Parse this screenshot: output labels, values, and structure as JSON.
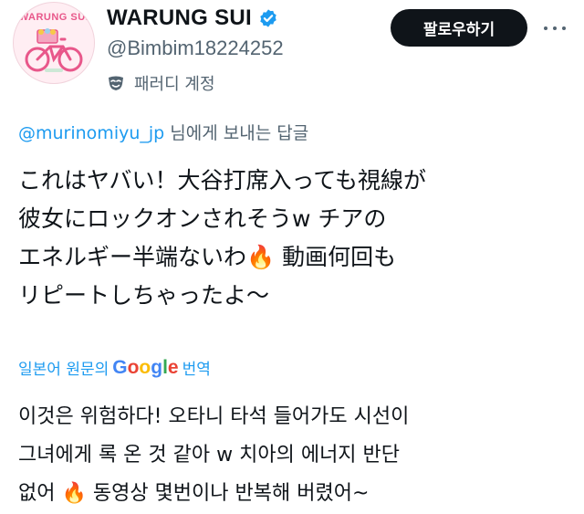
{
  "profile": {
    "avatar_brand": "WARUNG SUI",
    "display_name": "WARUNG SUI",
    "handle": "@Bimbim18224252",
    "parody_label": "패러디 계정",
    "icons": {
      "verified": "verified-badge-icon",
      "parody": "parody-mask-icon",
      "more": "more-options-icon"
    },
    "colors": {
      "verified": "#1d9bf0",
      "avatar_accent": "#e8578a"
    }
  },
  "actions": {
    "follow_label": "팔로우하기"
  },
  "reply_context": {
    "mention": "@murinomiyu_jp",
    "suffix": " 님에게 보내는 답글"
  },
  "tweet": {
    "original_lines": [
      "これはヤバい！大谷打席入っても視線が",
      "彼女にロックオンされそうw チアの",
      "エネルギー半端ないわ🔥 動画何回も",
      "リピートしちゃったよ〜"
    ],
    "translation_prefix": "일본어 원문의",
    "translation_brand": "Google",
    "translation_suffix": "번역",
    "translated_lines": [
      "이것은 위험하다! 오타니 타석 들어가도 시선이",
      "그녀에게 록 온 것 같아 w 치아의 에너지 반단",
      "없어 🔥 동영상 몇번이나 반복해 버렸어~"
    ]
  },
  "colors": {
    "link": "#1d9bf0",
    "muted": "#536471",
    "text": "#0f1419",
    "button": "#0f1419"
  }
}
